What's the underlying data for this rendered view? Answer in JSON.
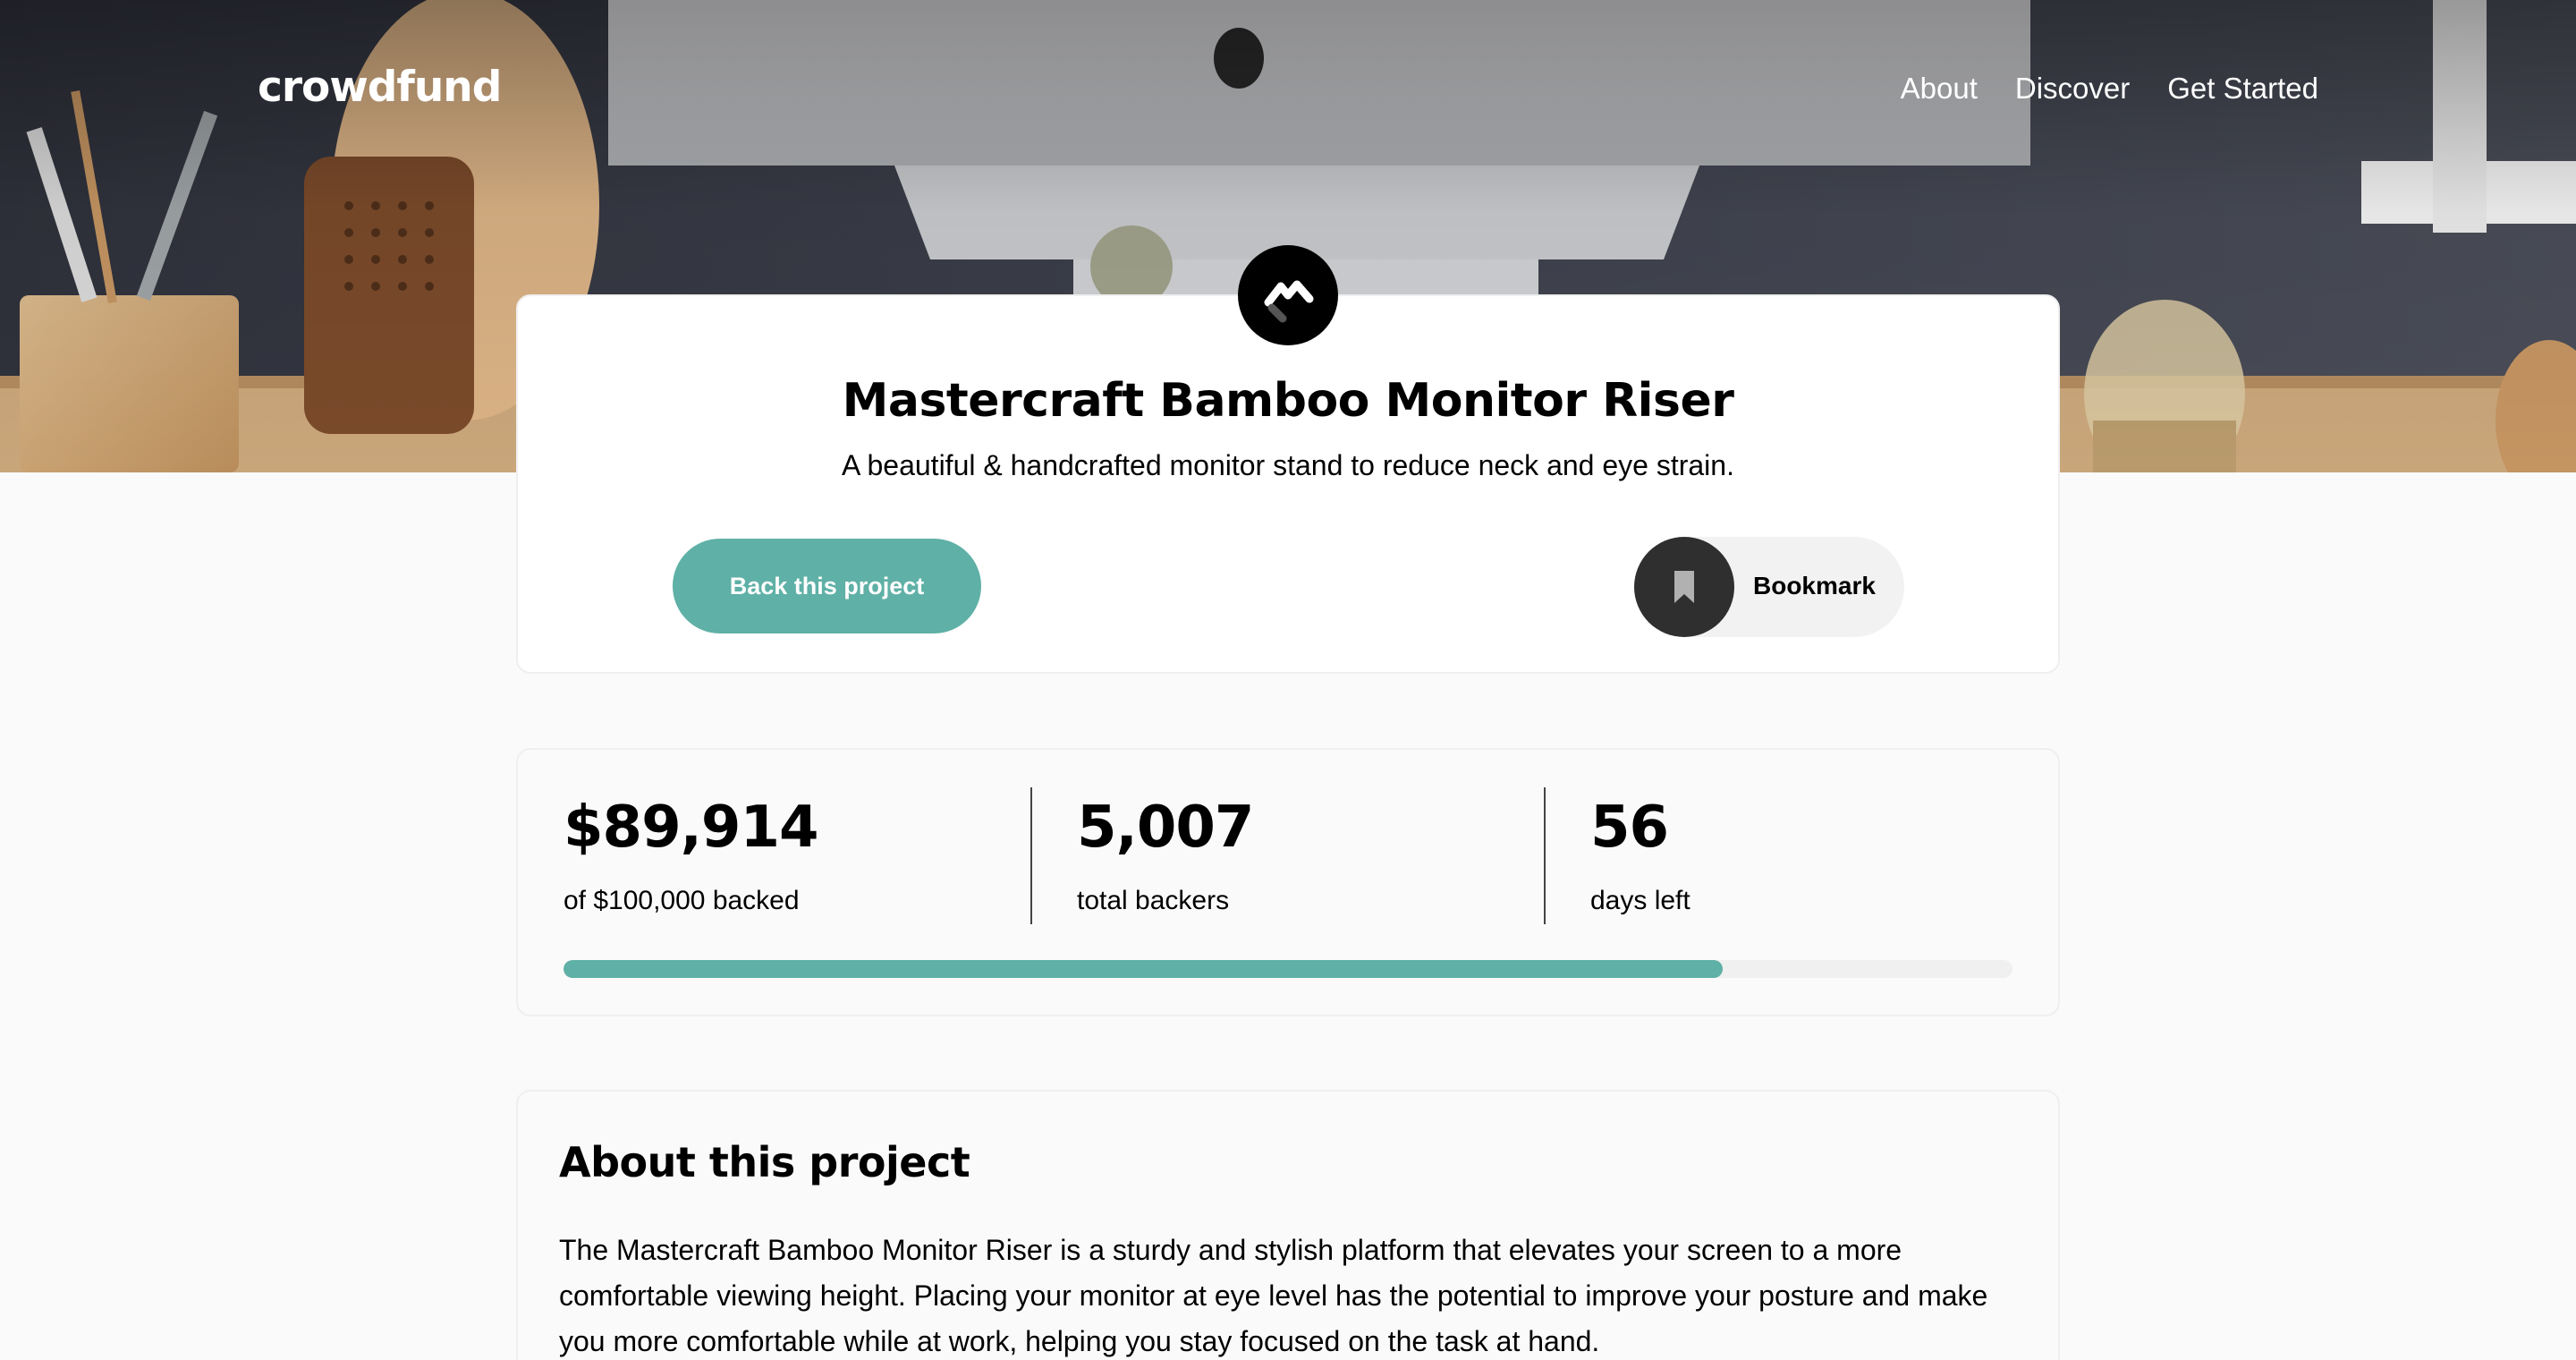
{
  "brand": {
    "logo_text": "crowdfund"
  },
  "nav": {
    "items": [
      {
        "label": "About"
      },
      {
        "label": "Discover"
      },
      {
        "label": "Get Started"
      }
    ]
  },
  "project": {
    "title": "Mastercraft Bamboo Monitor Riser",
    "tagline": "A beautiful & handcrafted monitor stand to reduce neck and eye strain.",
    "back_label": "Back this project",
    "bookmark_label": "Bookmark"
  },
  "stats": [
    {
      "value": "$89,914",
      "label": "of $100,000 backed"
    },
    {
      "value": "5,007",
      "label": "total backers"
    },
    {
      "value": "56",
      "label": "days left"
    }
  ],
  "progress": {
    "fraction": 0.8
  },
  "about": {
    "title": "About this project",
    "text": "The Mastercraft Bamboo Monitor Riser is a sturdy and stylish platform that elevates your screen to a more comfortable viewing height. Placing your monitor at eye level has the potential to improve your posture and make you more comfortable while at work, helping you stay focused on the task at hand."
  },
  "colors": {
    "accent": "#5fb0a6",
    "dark": "#2f2f2f",
    "background": "#fafafa"
  },
  "icons": {
    "brand_mark": "mastercraft-logo-icon",
    "bookmark": "bookmark-icon"
  }
}
